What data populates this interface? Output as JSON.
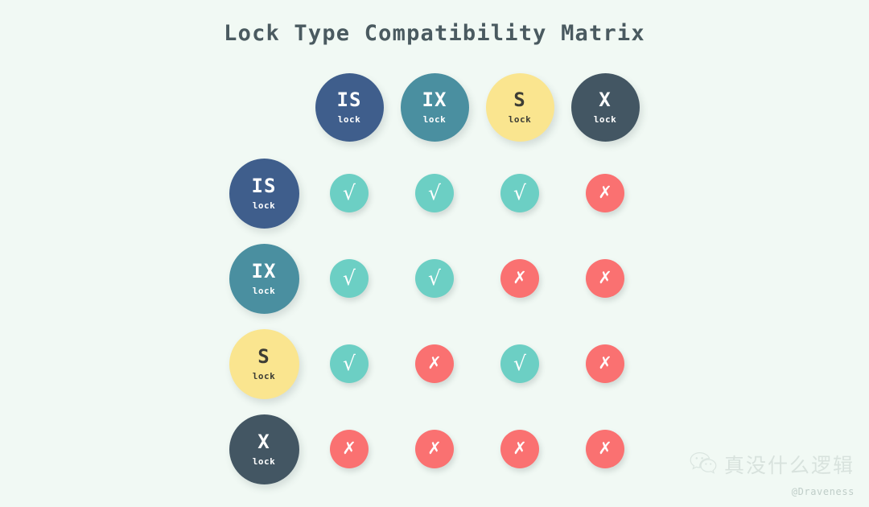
{
  "title": "Lock Type Compatibility Matrix",
  "theme": {
    "background": "#f1f9f4",
    "title_color": "#4a5a60",
    "compatible_color": "#6ccfc4",
    "conflict_color": "#fa7171"
  },
  "sub_label": "lock",
  "marks": {
    "compatible": "√",
    "conflict": "✗"
  },
  "lock_types": [
    {
      "code": "IS",
      "sub": "lock",
      "color": "#3f5e8c",
      "text_color": "#ffffff"
    },
    {
      "code": "IX",
      "sub": "lock",
      "color": "#4a8fa0",
      "text_color": "#ffffff"
    },
    {
      "code": "S",
      "sub": "lock",
      "color": "#fae58f",
      "text_color": "#3d3d35"
    },
    {
      "code": "X",
      "sub": "lock",
      "color": "#435663",
      "text_color": "#ffffff"
    }
  ],
  "chart_data": {
    "type": "heatmap",
    "title": "Lock Type Compatibility Matrix",
    "xlabel": "",
    "ylabel": "",
    "grid": false,
    "legend": "none",
    "categories": [
      "IS",
      "IX",
      "S",
      "X"
    ],
    "row_labels": [
      "IS",
      "IX",
      "S",
      "X"
    ],
    "column_labels": [
      "IS",
      "IX",
      "S",
      "X"
    ],
    "value_meaning": {
      "compatible": "compatible (√)",
      "conflict": "conflict (✗)"
    },
    "rows": [
      {
        "label": "IS",
        "cells": [
          "compatible",
          "compatible",
          "compatible",
          "conflict"
        ]
      },
      {
        "label": "IX",
        "cells": [
          "compatible",
          "compatible",
          "conflict",
          "conflict"
        ]
      },
      {
        "label": "S",
        "cells": [
          "compatible",
          "conflict",
          "compatible",
          "conflict"
        ]
      },
      {
        "label": "X",
        "cells": [
          "conflict",
          "conflict",
          "conflict",
          "conflict"
        ]
      }
    ]
  },
  "watermark": {
    "icon": "wechat-icon",
    "brand": "真没什么逻辑",
    "handle": "@Draveness"
  }
}
